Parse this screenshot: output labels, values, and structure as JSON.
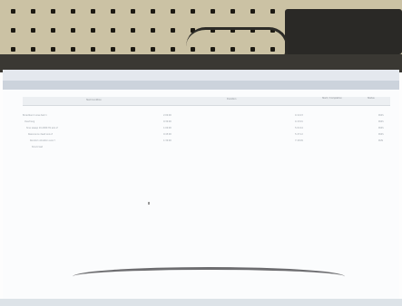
{
  "table": {
    "headers": [
      "Test Condition",
      "Duration",
      "Start / Completion",
      "Status"
    ],
    "rows": [
      [
        "Broadband noise test 1",
        "2:00:00",
        "4:12:23",
        "PASS"
      ],
      [
        "Overhang",
        "0:30:00",
        "4:15:01",
        "PASS"
      ],
      [
        "Sine sweep 10-2000 Hz axis Z",
        "1:00:00",
        "5:01:44",
        "PASS"
      ],
      [
        "Resonance dwell axis Z",
        "0:45:00",
        "5:47:12",
        "PASS"
      ],
      [
        "Random vibration axis Y",
        "1:30:00",
        "7:18:09",
        "RUN"
      ],
      [
        "Shock test",
        "",
        "",
        ""
      ]
    ]
  }
}
